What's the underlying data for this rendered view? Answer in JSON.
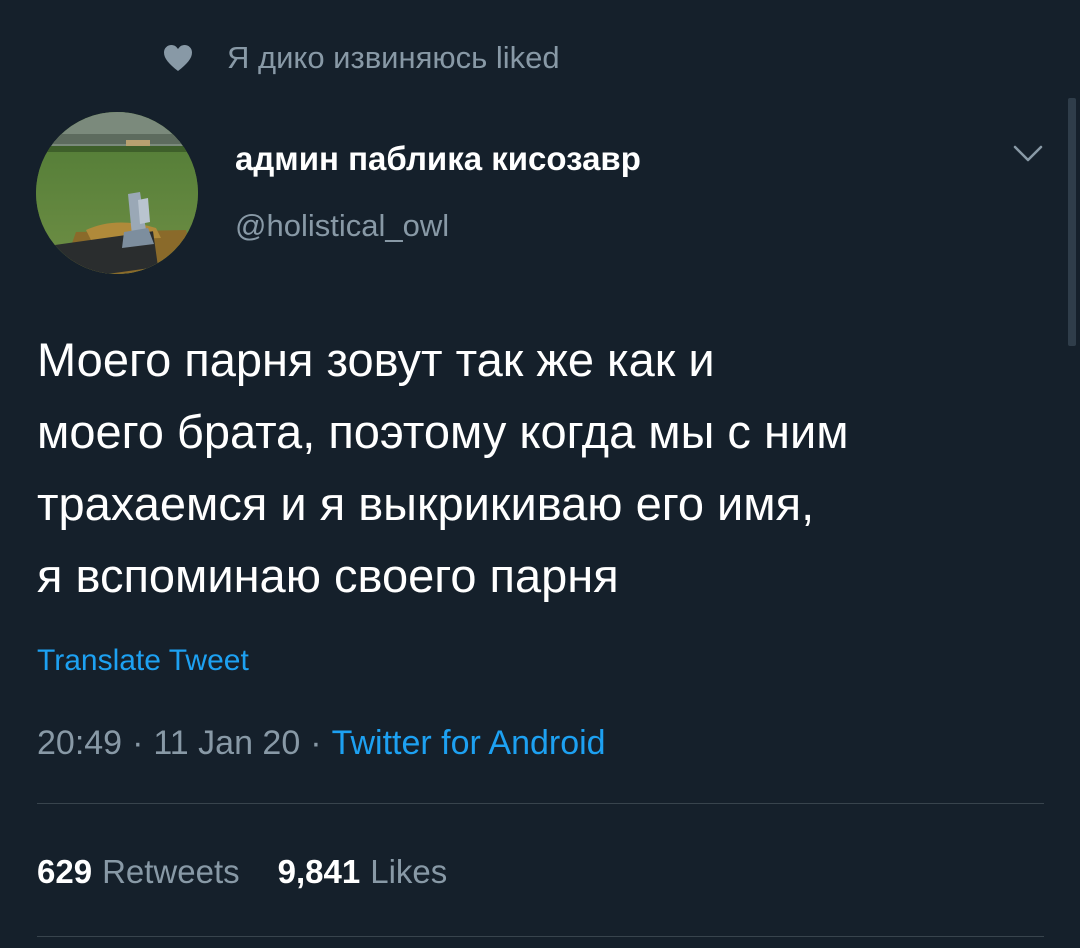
{
  "social_context": {
    "icon": "heart-icon",
    "text": "Я дико извиняюсь liked"
  },
  "tweet": {
    "author": {
      "display_name": "админ паблика кисозавр",
      "handle": "@holistical_owl",
      "avatar": "avatar-photo"
    },
    "menu_icon": "chevron-down-icon",
    "text_lines": [
      "Моего парня зовут так же как и",
      "моего брата, поэтому когда мы с ним",
      "трахаемся и я выкрикиваю его имя,",
      "я вспоминаю своего парня"
    ],
    "translate_label": "Translate Tweet",
    "time": "20:49",
    "separator": "·",
    "date": "11 Jan 20",
    "client": "Twitter for Android",
    "stats": {
      "retweets_count": "629",
      "retweets_label": "Retweets",
      "likes_count": "9,841",
      "likes_label": "Likes"
    }
  },
  "colors": {
    "background": "#15202b",
    "secondary_text": "#8899a6",
    "accent": "#1da1f2",
    "divider": "#38444d"
  }
}
